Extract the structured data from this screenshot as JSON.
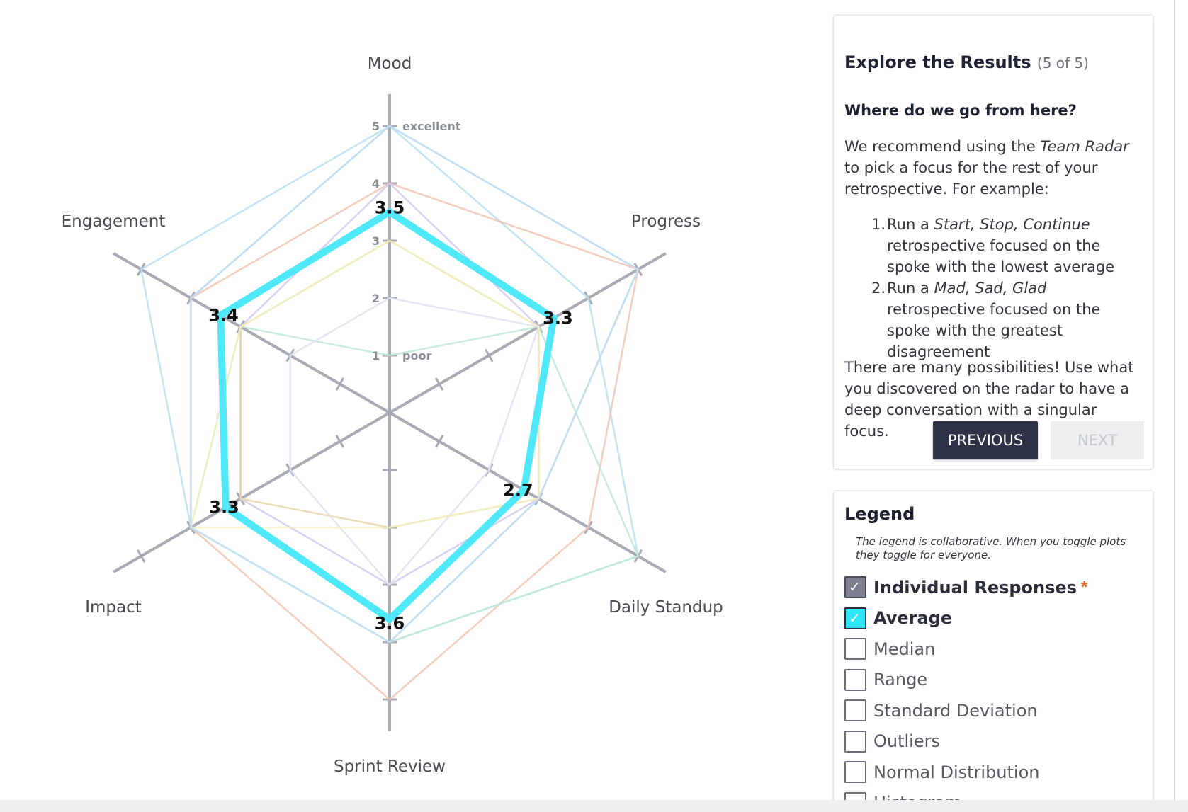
{
  "chart_data": {
    "type": "radar",
    "axes": [
      "Mood",
      "Progress",
      "Daily Standup",
      "Sprint Review",
      "Impact",
      "Engagement"
    ],
    "scale": {
      "min": 0,
      "max": 5,
      "ticks": [
        1,
        2,
        3,
        4,
        5
      ],
      "tick_labels": {
        "1": "poor",
        "5": "excellent"
      }
    },
    "average": {
      "name": "Average",
      "values": [
        3.5,
        3.3,
        2.7,
        3.6,
        3.3,
        3.4
      ],
      "color": "#4ee8f8"
    },
    "individual_responses": [
      {
        "values": [
          5,
          5,
          3,
          4,
          4,
          4
        ],
        "color": "#9fcbe6"
      },
      {
        "values": [
          5,
          4,
          5,
          4,
          4,
          5
        ],
        "color": "#b8dff0"
      },
      {
        "values": [
          4,
          5,
          4,
          5,
          4,
          4
        ],
        "color": "#f1c4b4"
      },
      {
        "values": [
          4,
          3,
          3,
          3,
          3,
          3
        ],
        "color": "#d4c8ee"
      },
      {
        "values": [
          3,
          3,
          3,
          2,
          3,
          3
        ],
        "color": "#e9d3a6"
      },
      {
        "values": [
          1,
          3,
          5,
          4,
          4,
          3
        ],
        "color": "#bfe8d8"
      },
      {
        "values": [
          2,
          3,
          2,
          3,
          2,
          2
        ],
        "color": "#dee2f2"
      },
      {
        "values": [
          3,
          3,
          3,
          2,
          4,
          3
        ],
        "color": "#f5eebf"
      },
      {
        "values": [
          5,
          5,
          3,
          4,
          4,
          4
        ],
        "color": "#c6e0f3"
      }
    ]
  },
  "explore": {
    "title": "Explore the Results",
    "step": "(5 of 5)",
    "subhead": "Where do we go from here?",
    "para1_a": "We recommend using the ",
    "para1_em": "Team Radar",
    "para1_b": " to pick a focus for the rest of your retrospective. For example:",
    "steps": [
      {
        "num": "1.",
        "a": "Run a ",
        "em": "Start, Stop, Continue",
        "b": " retrospective focused on the spoke with the lowest average"
      },
      {
        "num": "2.",
        "a": "Run a ",
        "em": "Mad, Sad, Glad",
        "b": " retrospective focused on the spoke with the greatest disagreement"
      }
    ],
    "para2": "There are many possibilities! Use what you discovered on the radar to have a deep conversation with a singular focus.",
    "previous_label": "PREVIOUS",
    "next_label": "NEXT"
  },
  "legend": {
    "title": "Legend",
    "note": "The legend is collaborative. When you toggle plots they toggle for everyone.",
    "items": [
      {
        "label": "Individual Responses",
        "checked": true,
        "star": "*"
      },
      {
        "label": "Average",
        "checked": true
      },
      {
        "label": "Median",
        "checked": false
      },
      {
        "label": "Range",
        "checked": false
      },
      {
        "label": "Standard Deviation",
        "checked": false
      },
      {
        "label": "Outliers",
        "checked": false
      },
      {
        "label": "Normal Distribution",
        "checked": false
      },
      {
        "label": "Histogram",
        "checked": false
      }
    ]
  }
}
